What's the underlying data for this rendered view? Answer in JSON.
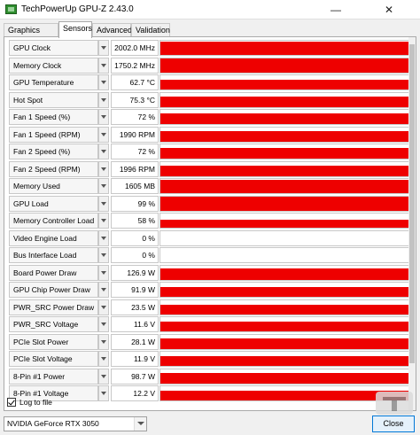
{
  "window": {
    "title": "TechPowerUp GPU-Z 2.43.0"
  },
  "tabs": [
    "Graphics Card",
    "Sensors",
    "Advanced",
    "Validation"
  ],
  "colors": {
    "graph": "#ee0000"
  },
  "sensors": [
    {
      "name": "GPU Clock",
      "value": "2002.0 MHz",
      "level": 0.95
    },
    {
      "name": "Memory Clock",
      "value": "1750.2 MHz",
      "level": 0.95
    },
    {
      "name": "GPU Temperature",
      "value": "62.7 °C",
      "level": 0.7
    },
    {
      "name": "Hot Spot",
      "value": "75.3 °C",
      "level": 0.7
    },
    {
      "name": "Fan 1 Speed (%)",
      "value": "72 %",
      "level": 0.72
    },
    {
      "name": "Fan 1 Speed (RPM)",
      "value": "1990 RPM",
      "level": 0.72
    },
    {
      "name": "Fan 2 Speed (%)",
      "value": "72 %",
      "level": 0.72
    },
    {
      "name": "Fan 2 Speed (RPM)",
      "value": "1996 RPM",
      "level": 0.72
    },
    {
      "name": "Memory Used",
      "value": "1605 MB",
      "level": 0.95
    },
    {
      "name": "GPU Load",
      "value": "99 %",
      "level": 0.99
    },
    {
      "name": "Memory Controller Load",
      "value": "58 %",
      "level": 0.58
    },
    {
      "name": "Video Engine Load",
      "value": "0 %",
      "level": 0
    },
    {
      "name": "Bus Interface Load",
      "value": "0 %",
      "level": 0
    },
    {
      "name": "Board Power Draw",
      "value": "126.9 W",
      "level": 0.8
    },
    {
      "name": "GPU Chip Power Draw",
      "value": "91.9 W",
      "level": 0.7
    },
    {
      "name": "PWR_SRC Power Draw",
      "value": "23.5 W",
      "level": 0.65
    },
    {
      "name": "PWR_SRC Voltage",
      "value": "11.6 V",
      "level": 0.7
    },
    {
      "name": "PCIe Slot Power",
      "value": "28.1 W",
      "level": 0.7
    },
    {
      "name": "PCIe Slot Voltage",
      "value": "11.9 V",
      "level": 0.7
    },
    {
      "name": "8-Pin #1 Power",
      "value": "98.7 W",
      "level": 0.7
    },
    {
      "name": "8-Pin #1 Voltage",
      "value": "12.2 V",
      "level": 0.7
    }
  ],
  "footer": {
    "log_label": "Log to file",
    "gpu_selected": "NVIDIA GeForce RTX 3050",
    "close_label": "Close"
  }
}
